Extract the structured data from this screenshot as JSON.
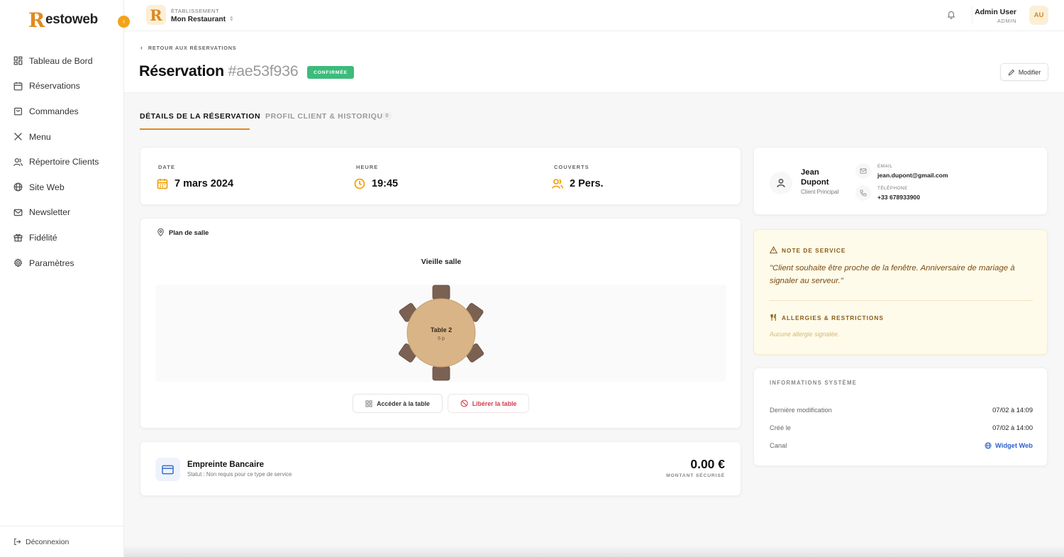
{
  "app": {
    "logo_r": "R",
    "logo_rest": "estoweb",
    "collapse_icon": "chevron-left-icon"
  },
  "sidebar": {
    "items": [
      {
        "label": "Tableau de Bord",
        "icon": "dashboard-icon"
      },
      {
        "label": "Réservations",
        "icon": "calendar-icon"
      },
      {
        "label": "Commandes",
        "icon": "shopping-bag-icon"
      },
      {
        "label": "Menu",
        "icon": "utensils-icon"
      },
      {
        "label": "Répertoire Clients",
        "icon": "users-icon"
      },
      {
        "label": "Site Web",
        "icon": "globe-icon"
      },
      {
        "label": "Newsletter",
        "icon": "mail-icon"
      },
      {
        "label": "Fidélité",
        "icon": "gift-icon"
      },
      {
        "label": "Paramètres",
        "icon": "gear-icon"
      }
    ],
    "logout": "Déconnexion"
  },
  "topbar": {
    "estab_initial": "R",
    "estab_label": "ÉTABLISSEMENT",
    "estab_name": "Mon Restaurant",
    "estab_chevron": "⇕",
    "user_name": "Admin User",
    "user_role": "ADMIN",
    "avatar_initials": "AU"
  },
  "header": {
    "back_label": "RETOUR AUX RÉSERVATIONS",
    "title": "Réservation",
    "code": "#ae53f936",
    "status_badge": "CONFIRMÉE",
    "status_color": "#3dbb7b",
    "modify_label": "Modifier"
  },
  "tabs": [
    {
      "label": "DÉTAILS DE LA RÉSERVATION",
      "active": true
    },
    {
      "label": "PROFIL CLIENT & HISTORIQUE",
      "count": "0"
    }
  ],
  "booking": {
    "date_label": "DATE",
    "date_value": "7 mars 2024",
    "time_label": "HEURE",
    "time_value": "19:45",
    "covers_label": "COUVERTS",
    "covers_value": "2 Pers."
  },
  "floor_plan": {
    "title": "Plan de salle",
    "room_name": "Vieille salle",
    "table_name": "Table 2",
    "table_capacity": "6 p",
    "access_button": "Accéder à la table",
    "free_button": "Libérer la table"
  },
  "bank": {
    "title": "Empreinte Bancaire",
    "status": "Statut : Non requis pour ce type de service",
    "amount": "0.00 €",
    "amount_label": "MONTANT SÉCURISÉ"
  },
  "client": {
    "name": "Jean Dupont",
    "role": "Client Principal",
    "email_label": "EMAIL",
    "email": "jean.dupont@gmail.com",
    "phone_label": "TÉLÉPHONE",
    "phone": "+33 678933900"
  },
  "note": {
    "title": "NOTE DE SERVICE",
    "text": "\"Client souhaite être proche de la fenêtre. Anniversaire de mariage à signaler au serveur.\"",
    "allergies_title": "ALLERGIES & RESTRICTIONS",
    "allergies_text": "Aucune allergie signalée."
  },
  "system": {
    "title": "INFORMATIONS SYSTÈME",
    "rows": [
      {
        "label": "Dernière modification",
        "value": "07/02 à 14:09"
      },
      {
        "label": "Créé le",
        "value": "07/02 à 14:00"
      },
      {
        "label": "Canal",
        "value": "Widget Web"
      }
    ]
  },
  "colors": {
    "accent": "#e08a1e",
    "icon_orange": "#f0a316",
    "link_blue": "#2e61c9",
    "danger": "#d43a4a"
  }
}
